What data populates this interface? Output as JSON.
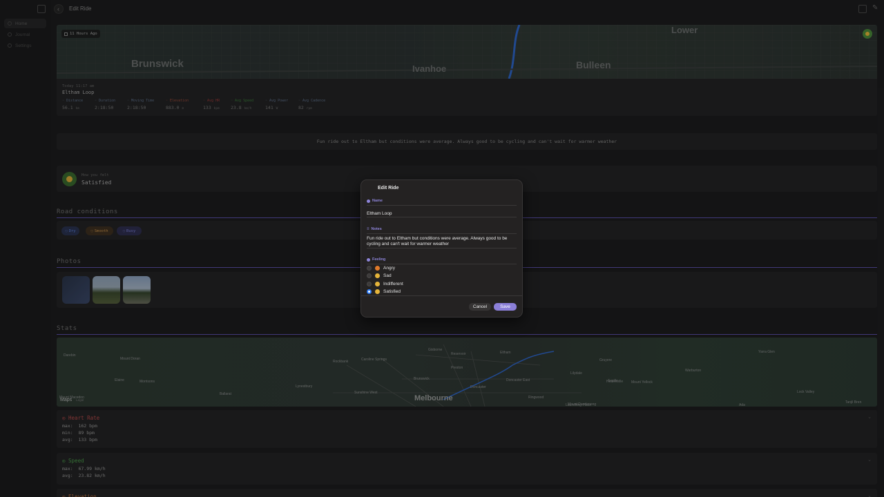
{
  "window": {
    "title": "Edit Ride"
  },
  "sidebar": {
    "items": [
      {
        "label": "Home",
        "active": true
      },
      {
        "label": "Journal",
        "active": false
      },
      {
        "label": "Settings",
        "active": false
      }
    ]
  },
  "ride": {
    "badge": "11 Hours Ago",
    "map_places": [
      "Brunswick",
      "Ivanhoe",
      "Bulleen",
      "Lower"
    ],
    "date": "Today  11:17 am",
    "name": "Eltham Loop",
    "stats": [
      {
        "label": "Distance",
        "value": "56.1",
        "unit": "km",
        "color": "#5e6f8a"
      },
      {
        "label": "Duration",
        "value": "2:18:50",
        "unit": "",
        "color": "#5e6f8a"
      },
      {
        "label": "Moving Time",
        "value": "2:18:50",
        "unit": "",
        "color": "#5e6f8a"
      },
      {
        "label": "Elevation",
        "value": "883.0",
        "unit": "m",
        "color": "#9a4a3a"
      },
      {
        "label": "Avg HR",
        "value": "133",
        "unit": "bpm",
        "color": "#9a3a3a"
      },
      {
        "label": "Avg Speed",
        "value": "23.8",
        "unit": "km/h",
        "color": "#3a7a3a"
      },
      {
        "label": "Avg Power",
        "value": "141",
        "unit": "W",
        "color": "#5e6f8a"
      },
      {
        "label": "Avg Cadence",
        "value": "82",
        "unit": "rpm",
        "color": "#5e6f8a"
      }
    ],
    "notes": "Fun ride out to Eltham but conditions were average. Always good to be cycling and can't wait for warmer weather",
    "feeling_label": "How you felt",
    "feeling": "Satisfied"
  },
  "sections": {
    "road": "Road conditions",
    "photos": "Photos",
    "stats": "Stats"
  },
  "road_tags": [
    {
      "label": "Dry",
      "color": "#5b7fd6",
      "bg": "#2a3350"
    },
    {
      "label": "Smooth",
      "color": "#c8914a",
      "bg": "#3d3021"
    },
    {
      "label": "Busy",
      "color": "#7a7fd6",
      "bg": "#2f2f4f"
    }
  ],
  "stats_map": {
    "places": [
      "Darebin",
      "Mount Doran",
      "Elaine",
      "Morrisons",
      "Ballarat",
      "Lynestbury",
      "Rockbank",
      "Caroline Springs",
      "Sunshine West",
      "Brunswick",
      "Preston",
      "Reservoir",
      "Doncaster",
      "Doncaster East",
      "Eltham",
      "Lilydale",
      "Ringwood",
      "Mount Yellock",
      "Warburton",
      "Healesville",
      "Yarra Glen",
      "Gruyere",
      "Seville",
      "Launching Place",
      "Ada",
      "Lock Valley",
      "Tanjil Bren",
      "Mount Dandenong",
      "Gisborne",
      "Mount Macedon"
    ],
    "main_city": "Melbourne",
    "brand": "Maps",
    "legal": "Legal"
  },
  "metrics": [
    {
      "title": "Heart Rate",
      "color": "#b34a4a",
      "lines": [
        "max:  162 bpm",
        "min:  89 bpm",
        "avg:  133 bpm"
      ]
    },
    {
      "title": "Speed",
      "color": "#4a9a4a",
      "lines": [
        "max:  67.99 km/h",
        "avg:  23.82 km/h"
      ]
    },
    {
      "title": "Elevation",
      "color": "#b36a3a",
      "lines": []
    }
  ],
  "modal": {
    "title": "Edit Ride",
    "name_label": "Name",
    "name_value": "Eltham Loop",
    "notes_label": "Notes",
    "notes_value": "Fun ride out to Eltham but conditions were average. Always good to be cycling and can't wait for warmer weather",
    "feeling_label": "Feeling",
    "options": [
      {
        "label": "Angry",
        "checked": false,
        "emoji_color": "#e07a2a"
      },
      {
        "label": "Sad",
        "checked": false,
        "emoji_color": "#e5b43a"
      },
      {
        "label": "Indifferent",
        "checked": false,
        "emoji_color": "#e5b43a"
      },
      {
        "label": "Satisfied",
        "checked": true,
        "emoji_color": "#e5b43a"
      }
    ],
    "cancel": "Cancel",
    "save": "Save",
    "accent": "#8b7fd8"
  }
}
